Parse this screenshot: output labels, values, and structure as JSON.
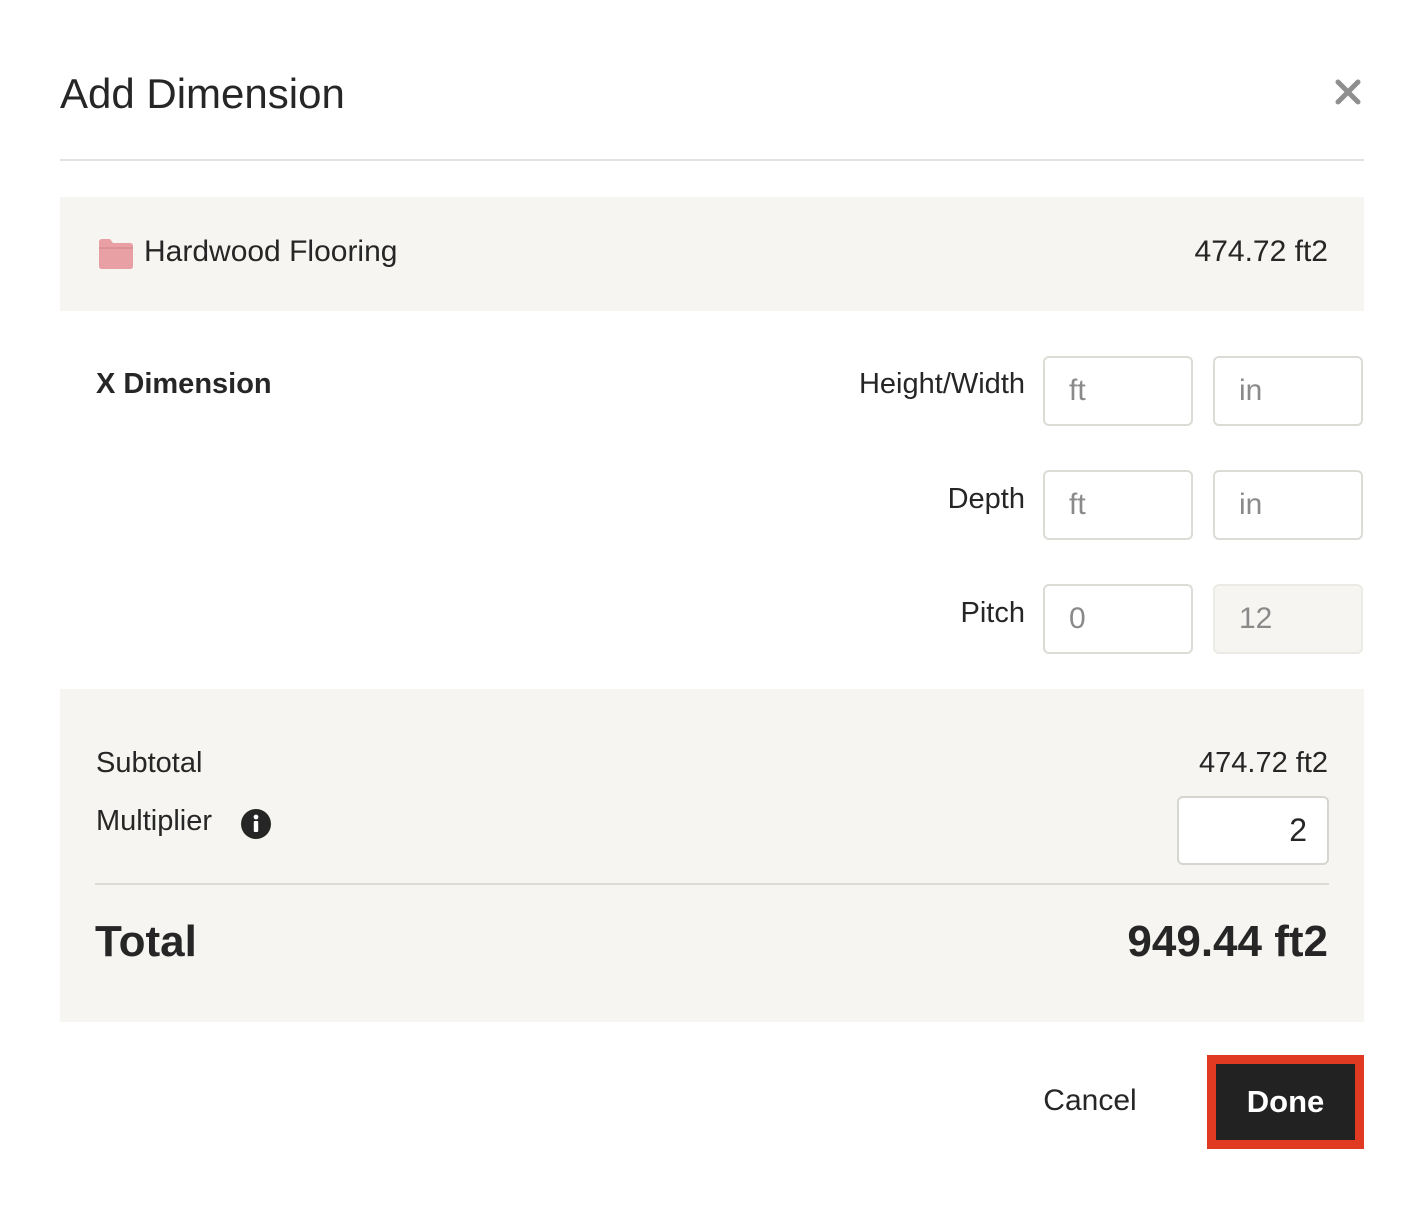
{
  "dialog": {
    "title": "Add Dimension",
    "close_icon": "close-icon"
  },
  "category": {
    "icon": "folder-icon",
    "icon_color": "#e8a0a4",
    "name": "Hardwood Flooring",
    "total": "474.72 ft2"
  },
  "dimension": {
    "label": "X Dimension",
    "rows": [
      {
        "label": "Height/Width",
        "field_a_placeholder": "ft",
        "field_b_placeholder": "in"
      },
      {
        "label": "Depth",
        "field_a_placeholder": "ft",
        "field_b_placeholder": "in"
      },
      {
        "label": "Pitch",
        "field_a_placeholder": "0",
        "field_b_value": "12"
      }
    ]
  },
  "summary": {
    "subtotal_label": "Subtotal",
    "subtotal_value": "474.72 ft2",
    "multiplier_label": "Multiplier",
    "multiplier_info_icon": "info-icon",
    "multiplier_value": "2",
    "total_label": "Total",
    "total_value": "949.44 ft2"
  },
  "actions": {
    "cancel_label": "Cancel",
    "done_label": "Done",
    "done_highlight_color": "#e03a22",
    "done_bg_color": "#222222"
  }
}
